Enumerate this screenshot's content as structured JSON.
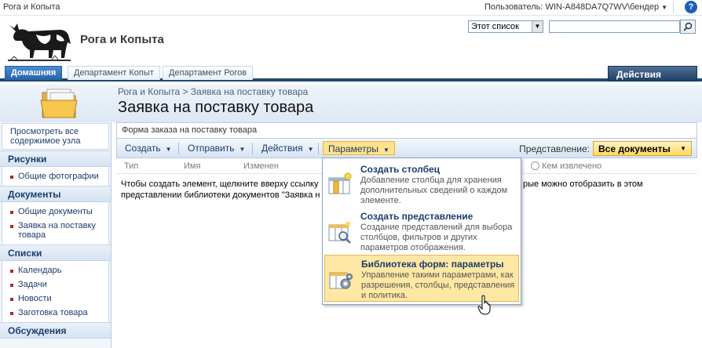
{
  "topbar": {
    "site_link": "Рога и Копыта",
    "welcome": "Пользователь: WIN-A848DA7Q7WV\\бендер",
    "help_glyph": "?"
  },
  "header": {
    "site_title": "Рога и Копыта",
    "search_scope": "Этот список",
    "search_value": ""
  },
  "nav": {
    "tabs": [
      "Домашняя",
      "Департамент Копыт",
      "Департамент Рогов"
    ],
    "site_actions": "Действия узла"
  },
  "title_area": {
    "breadcrumb": "Рога и Копыта > Заявка на поставку товара",
    "page_title": "Заявка на поставку товара"
  },
  "quicklaunch": {
    "view_all": "Просмотреть все содержимое узла",
    "pictures": {
      "header": "Рисунки",
      "items": [
        "Общие фотографии"
      ]
    },
    "documents": {
      "header": "Документы",
      "items": [
        "Общие документы",
        "Заявка на поставку товара"
      ]
    },
    "lists": {
      "header": "Списки",
      "items": [
        "Календарь",
        "Задачи",
        "Новости",
        "Заготовка товара"
      ]
    },
    "discussions": {
      "header": "Обсуждения"
    }
  },
  "main": {
    "description": "Форма заказа на поставку товара",
    "toolbar": {
      "create": "Создать",
      "send": "Отправить",
      "actions": "Действия",
      "settings": "Параметры",
      "view_label": "Представление:",
      "view_value": "Все документы"
    },
    "columns": [
      "Тип",
      "Имя",
      "Изменен",
      "Кем извлечено"
    ],
    "empty_message": {
      "line1a": "Чтобы создать элемент, щелкните вверху ссылку",
      "line1b": "рые можно отобразить в этом",
      "line2": "представлении библиотеки документов \"Заявка н"
    }
  },
  "menu": {
    "items": [
      {
        "title": "Создать столбец",
        "desc": "Добавление столбца для хранения дополнительных сведений о каждом элементе."
      },
      {
        "title": "Создать представление",
        "desc": "Создание представлений для выбора столбцов, фильтров и других параметров отображения."
      },
      {
        "title": "Библиотека форм: параметры",
        "desc": "Управление такими параметрами, как разрешения, столбцы, представления и политика."
      }
    ]
  },
  "colors": {
    "nav_dark": "#21476d",
    "link": "#1c3d6e",
    "highlight": "#ffe8a4",
    "active_tab": "#2563a8"
  },
  "icons": [
    "help-icon",
    "search-icon",
    "folder-icon",
    "add-column-icon",
    "create-view-icon",
    "library-settings-icon",
    "hand-cursor-icon"
  ]
}
